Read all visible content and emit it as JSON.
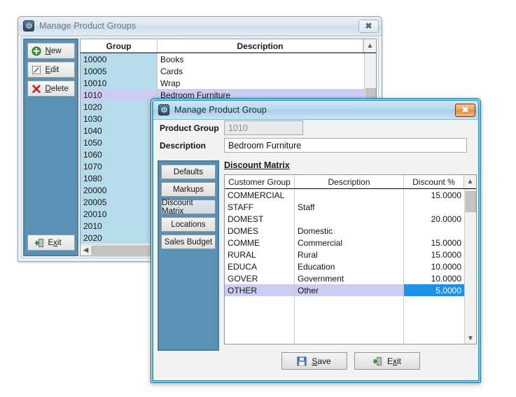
{
  "back_window": {
    "title": "Manage Product Groups",
    "app_icon": "power-icon",
    "close_label": "✖",
    "toolbar": {
      "new_label": "New",
      "edit_label": "Edit",
      "delete_label": "Delete",
      "exit_label": "Exit"
    },
    "grid": {
      "columns": [
        "Group",
        "Description"
      ],
      "rows": [
        {
          "group": "10000",
          "description": "Books"
        },
        {
          "group": "10005",
          "description": "Cards"
        },
        {
          "group": "10010",
          "description": "Wrap"
        },
        {
          "group": "1010",
          "description": "Bedroom Furniture"
        },
        {
          "group": "1020",
          "description": ""
        },
        {
          "group": "1030",
          "description": ""
        },
        {
          "group": "1040",
          "description": ""
        },
        {
          "group": "1050",
          "description": ""
        },
        {
          "group": "1060",
          "description": ""
        },
        {
          "group": "1070",
          "description": ""
        },
        {
          "group": "1080",
          "description": ""
        },
        {
          "group": "20000",
          "description": ""
        },
        {
          "group": "20005",
          "description": ""
        },
        {
          "group": "20010",
          "description": ""
        },
        {
          "group": "2010",
          "description": ""
        },
        {
          "group": "2020",
          "description": ""
        }
      ],
      "selected_index": 3
    }
  },
  "front_window": {
    "title": "Manage Product Group",
    "app_icon": "power-icon",
    "close_label": "✖",
    "form": {
      "product_group_label": "Product Group",
      "product_group_value": "1010",
      "description_label": "Description",
      "description_value": "Bedroom Furniture"
    },
    "tabs": [
      {
        "label": "Defaults",
        "active": false
      },
      {
        "label": "Markups",
        "active": false
      },
      {
        "label": "Discount Matrix",
        "active": true
      },
      {
        "label": "Locations",
        "active": false
      },
      {
        "label": "Sales Budget",
        "active": false
      }
    ],
    "matrix": {
      "title": "Discount Matrix",
      "columns": [
        "Customer Group",
        "Description",
        "Discount %"
      ],
      "rows": [
        {
          "customer_group": "COMMERCIAL",
          "description": "",
          "discount": "15.0000"
        },
        {
          "customer_group": "STAFF",
          "description": "Staff",
          "discount": ""
        },
        {
          "customer_group": "DOMEST",
          "description": "",
          "discount": "20.0000"
        },
        {
          "customer_group": "DOMES",
          "description": "Domestic",
          "discount": ""
        },
        {
          "customer_group": "COMME",
          "description": "Commercial",
          "discount": "15.0000"
        },
        {
          "customer_group": "RURAL",
          "description": "Rural",
          "discount": "15.0000"
        },
        {
          "customer_group": "EDUCA",
          "description": "Education",
          "discount": "10.0000"
        },
        {
          "customer_group": "GOVER",
          "description": "Government",
          "discount": "10.0000"
        },
        {
          "customer_group": "OTHER",
          "description": "Other",
          "discount": "5.0000"
        }
      ],
      "selected_index": 8
    },
    "buttons": {
      "save_label": "Save",
      "exit_label": "Exit"
    }
  },
  "colors": {
    "panel_blue": "#5b91b5",
    "row_blue": "#b6dceb",
    "selection_lilac": "#ccccf2",
    "cell_highlight": "#1e90e8",
    "active_border": "#29a8e0"
  }
}
